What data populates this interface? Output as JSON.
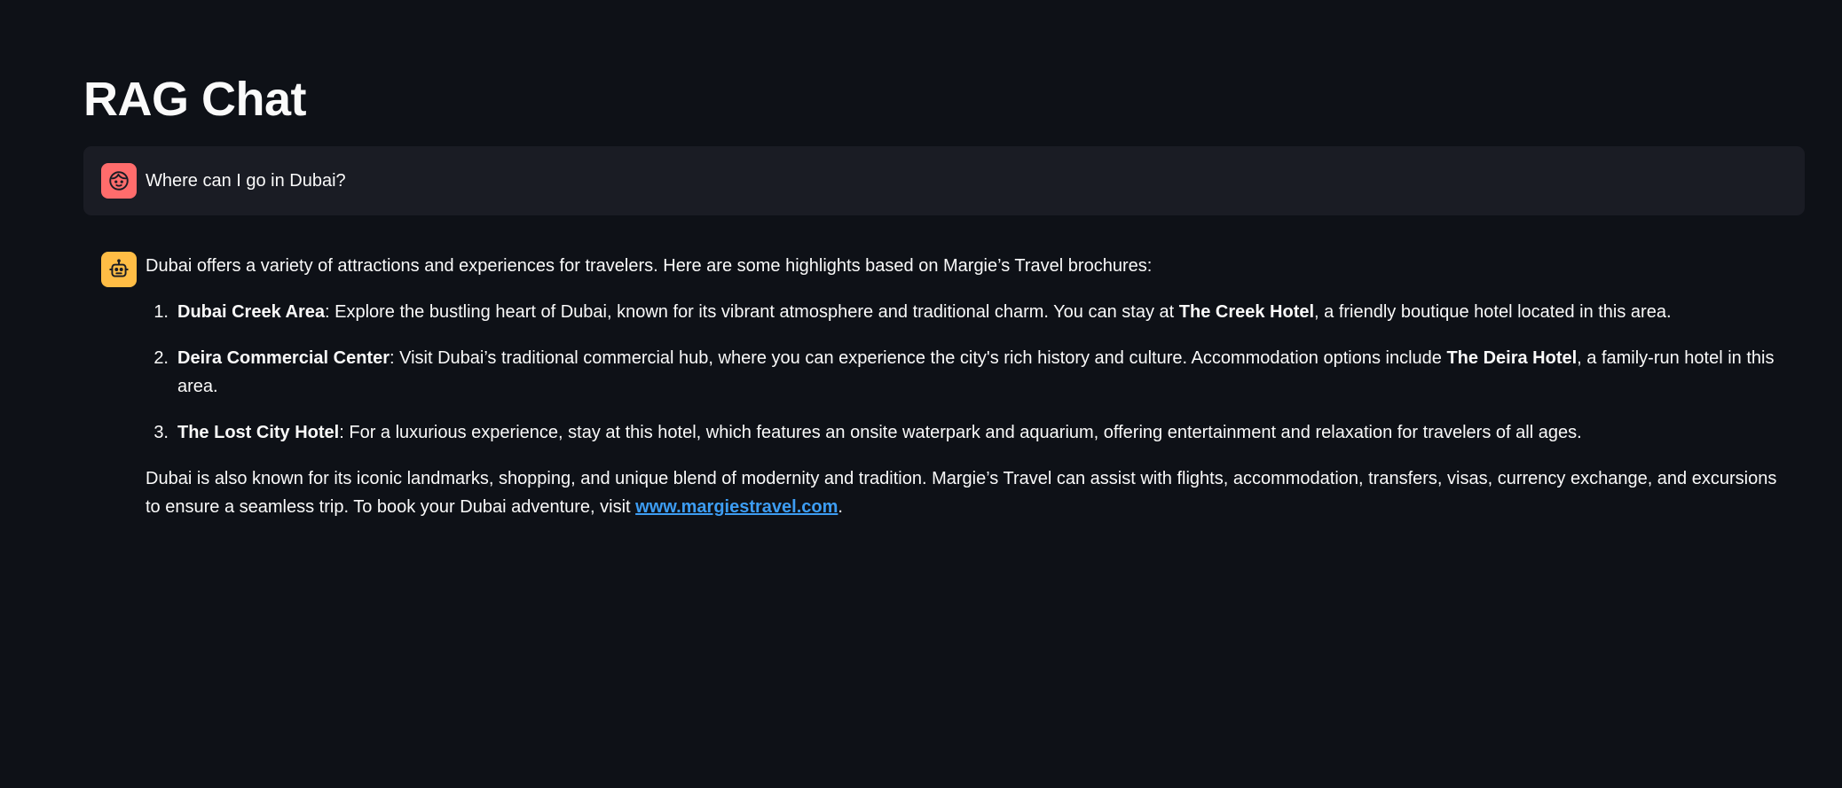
{
  "page": {
    "title": "RAG Chat"
  },
  "colors": {
    "background": "#0e1117",
    "user_message_bg": "#1a1c24",
    "user_avatar": "#ff6c6c",
    "assistant_avatar": "#ffbd45",
    "link": "#3d9df3"
  },
  "messages": {
    "user": {
      "avatar_icon": "user-face-icon",
      "text": "Where can I go in Dubai?"
    },
    "assistant": {
      "avatar_icon": "robot-face-icon",
      "intro": "Dubai offers a variety of attractions and experiences for travelers. Here are some highlights based on Margie’s Travel brochures:",
      "items": [
        {
          "number": "1.",
          "title": "Dubai Creek Area",
          "text_a": ": Explore the bustling heart of Dubai, known for its vibrant atmosphere and traditional charm. You can stay at ",
          "hotel": "The Creek Hotel",
          "text_b": ", a friendly boutique hotel located in this area."
        },
        {
          "number": "2.",
          "title": "Deira Commercial Center",
          "text_a": ": Visit Dubai’s traditional commercial hub, where you can experience the city's rich history and culture. Accommodation options include ",
          "hotel": "The Deira Hotel",
          "text_b": ", a family-run hotel in this area."
        },
        {
          "number": "3.",
          "title": "The Lost City Hotel",
          "text_a": ": For a luxurious experience, stay at this hotel, which features an onsite waterpark and aquarium, offering entertainment and relaxation for travelers of all ages."
        }
      ],
      "outro_text": "Dubai is also known for its iconic landmarks, shopping, and unique blend of modernity and tradition. Margie’s Travel can assist with flights, accommodation, transfers, visas, currency exchange, and excursions to ensure a seamless trip. To book your Dubai adventure, visit ",
      "outro_link": "www.margiestravel.com",
      "outro_end": "."
    }
  }
}
